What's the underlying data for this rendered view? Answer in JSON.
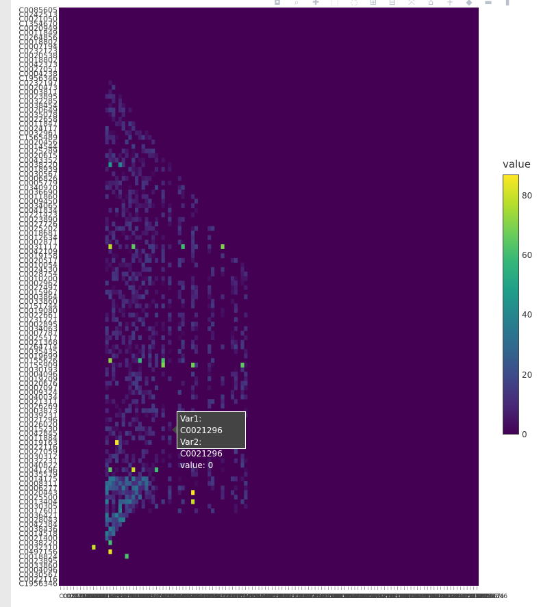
{
  "modebar": {
    "icons": [
      "camera-icon",
      "zoom-icon",
      "pan-icon",
      "box-select-icon",
      "lasso-icon",
      "zoom-in-icon",
      "zoom-out-icon",
      "autoscale-icon",
      "reset-axes-icon",
      "spike-lines-icon",
      "hover-closest-icon",
      "hover-compare-icon",
      "plotly-logo-icon"
    ],
    "glyphs": [
      "◘",
      "⌕",
      "✚",
      "⬚",
      "◌",
      "⊞",
      "⊟",
      "⤧",
      "⌂",
      "┼",
      "◆",
      "▬",
      "▮"
    ]
  },
  "colors": {
    "viridis": [
      "#440154",
      "#482878",
      "#3e4989",
      "#31688e",
      "#26828e",
      "#1f9e89",
      "#35b779",
      "#6ece58",
      "#b5de2b",
      "#fde725"
    ],
    "background": "#440154",
    "tooltip_bg": "#444444"
  },
  "chart_data": {
    "type": "heatmap",
    "title": "",
    "xlabel": "",
    "ylabel": "",
    "colorbar": {
      "title": "value",
      "range": [
        0,
        87
      ],
      "ticks": [
        0,
        20,
        40,
        60,
        80
      ]
    },
    "y_categories": [
      "C0085605",
      "C0242513",
      "C0021050",
      "C1354670",
      "C0020949",
      "C0011849",
      "C0264856",
      "C0018802",
      "C0007194",
      "C0232123",
      "C0020538",
      "C0018802",
      "C0042373",
      "C0027051",
      "C0004238",
      "C1956346",
      "C0232197",
      "C0020473",
      "C0003811",
      "C0023895",
      "C0032285",
      "C0038454",
      "C0020649",
      "C0035078",
      "C0022658",
      "C0011847",
      "C0024117",
      "C0032961",
      "C1565489",
      "C0020456",
      "C0014544",
      "C0025289",
      "C0020615",
      "C0043352",
      "C0038220",
      "C0018939",
      "C0030567",
      "C0006826",
      "C0005779",
      "C0340970",
      "C0036690",
      "C0011860",
      "C0009450",
      "C0034065",
      "C0041834",
      "C0221423",
      "C0023890",
      "C0027726",
      "C0025202",
      "C0018681",
      "C0012634",
      "C0002871",
      "C0031117",
      "C0042109",
      "C0019158",
      "C0020517",
      "C0010054",
      "C0024530",
      "C0028754",
      "C0010200",
      "C0002962",
      "C0027497",
      "C0015967",
      "C0003864",
      "C0033860",
      "C0151744",
      "C0019080",
      "C0022661",
      "C0231221",
      "C0002895",
      "C0034063",
      "C0007787",
      "C0025517",
      "C0021368",
      "C0264714",
      "C0035435",
      "C0019699",
      "C0155626",
      "C0155909",
      "C0030193",
      "C0004096",
      "C0019209",
      "C0020676",
      "C0007097",
      "C0009324",
      "C0040034",
      "C0021311",
      "C0026269",
      "C0003873",
      "C0039231",
      "C0021296",
      "C0026020",
      "C0015230",
      "C0042845",
      "C0011884",
      "C0019163",
      "C0022116",
      "C0027059",
      "C0030312",
      "C0032231",
      "C0040822",
      "C0041296",
      "C0035579",
      "C0014175",
      "C0008311",
      "C0006277",
      "C0020443",
      "C0025500",
      "C0013404",
      "C0030305",
      "C0017601",
      "C0036421",
      "C0028043",
      "C0042384",
      "C0038436",
      "C0014518",
      "C0021400",
      "C0038220",
      "C0032310",
      "C0497156",
      "C0018824",
      "C0023895",
      "C0033860",
      "C0004096",
      "C0030567",
      "C0022116",
      "C1956346"
    ],
    "x_categories_note": "same ordering as y_categories",
    "hover": {
      "var1": "Var1: C0021296",
      "var2": "Var2: C0021296",
      "value": "value: 0"
    },
    "colorbar_tick_labels": [
      "0",
      "20",
      "40",
      "60",
      "80"
    ],
    "colorbar_label": "value",
    "n_categories": 127,
    "hot_cells": [
      {
        "row": 52,
        "col": 15,
        "value": 78
      },
      {
        "row": 52,
        "col": 22,
        "value": 65
      },
      {
        "row": 52,
        "col": 49,
        "value": 70
      },
      {
        "row": 52,
        "col": 37,
        "value": 60
      },
      {
        "row": 77,
        "col": 15,
        "value": 72
      },
      {
        "row": 77,
        "col": 24,
        "value": 58
      },
      {
        "row": 77,
        "col": 31,
        "value": 62
      },
      {
        "row": 78,
        "col": 31,
        "value": 70
      },
      {
        "row": 78,
        "col": 40,
        "value": 68
      },
      {
        "row": 78,
        "col": 55,
        "value": 65
      },
      {
        "row": 95,
        "col": 17,
        "value": 86
      },
      {
        "row": 95,
        "col": 49,
        "value": 84
      },
      {
        "row": 95,
        "col": 55,
        "value": 70
      },
      {
        "row": 95,
        "col": 40,
        "value": 55
      },
      {
        "row": 101,
        "col": 15,
        "value": 64
      },
      {
        "row": 101,
        "col": 22,
        "value": 80
      },
      {
        "row": 101,
        "col": 29,
        "value": 60
      },
      {
        "row": 106,
        "col": 40,
        "value": 86
      },
      {
        "row": 108,
        "col": 40,
        "value": 80
      },
      {
        "row": 117,
        "col": 15,
        "value": 60
      },
      {
        "row": 119,
        "col": 15,
        "value": 84
      },
      {
        "row": 118,
        "col": 10,
        "value": 80
      },
      {
        "row": 120,
        "col": 20,
        "value": 62
      },
      {
        "row": 34,
        "col": 15,
        "value": 45
      },
      {
        "row": 34,
        "col": 18,
        "value": 40
      }
    ]
  }
}
